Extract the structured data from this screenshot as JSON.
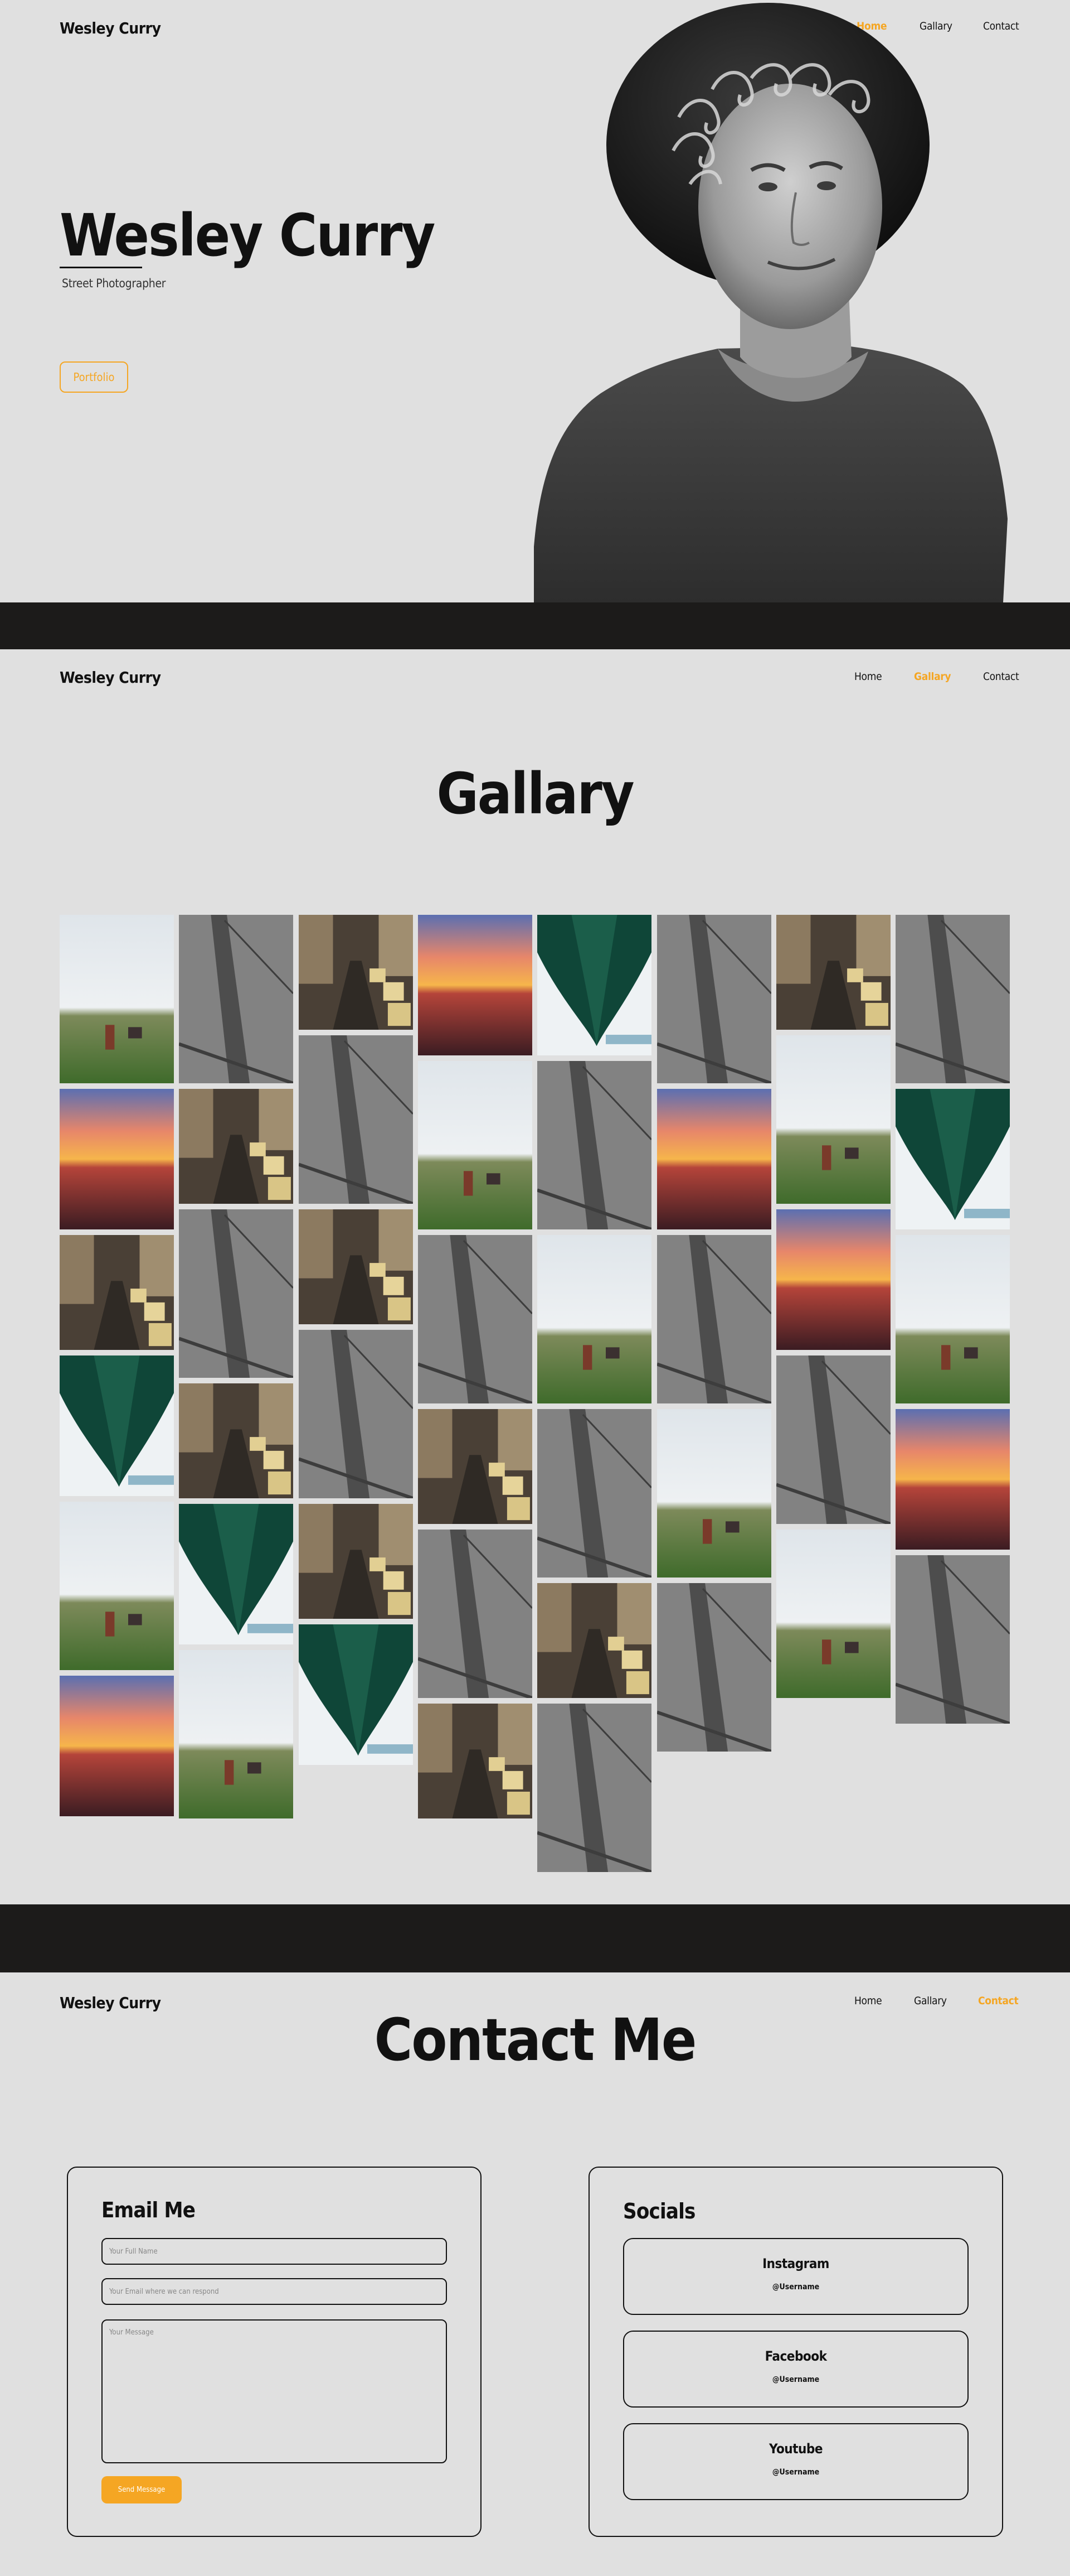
{
  "brand": "Wesley Curry",
  "colors": {
    "accent": "#f5a623",
    "background": "#e0e0e0",
    "band": "#1c1b1a",
    "text": "#111111"
  },
  "nav": [
    {
      "label": "Home"
    },
    {
      "label": "Gallary"
    },
    {
      "label": "Contact"
    }
  ],
  "hero": {
    "title": "Wesley Curry",
    "subtitle": "Street Photographer",
    "button": "Portfolio",
    "image": "portrait-photo"
  },
  "gallery": {
    "title": "Gallary",
    "photo_types": [
      "field-photo",
      "sunset-photo",
      "street-photo",
      "bridge-photo",
      "green-bridge-photo"
    ]
  },
  "contact": {
    "title": "Contact Me",
    "form": {
      "title": "Email Me",
      "name_placeholder": "Your Full Name",
      "email_placeholder": "Your Email where we can respond",
      "message_placeholder": "Your Message",
      "submit": "Send Message"
    },
    "socials": {
      "title": "Socials",
      "items": [
        {
          "name": "Instagram",
          "handle": "@Username",
          "icon": "instagram-icon"
        },
        {
          "name": "Facebook",
          "handle": "@Username",
          "icon": "facebook-icon"
        },
        {
          "name": "Youtube",
          "handle": "@Username",
          "icon": "youtube-icon"
        }
      ]
    }
  }
}
